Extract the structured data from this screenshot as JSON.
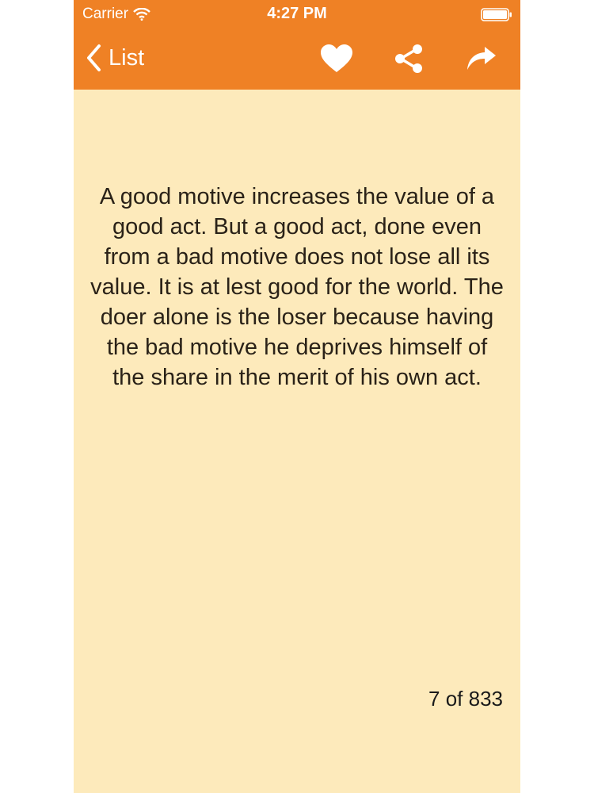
{
  "status_bar": {
    "carrier": "Carrier",
    "time": "4:27 PM",
    "icons": [
      "wifi-icon",
      "battery-icon"
    ]
  },
  "nav_bar": {
    "back_label": "List",
    "icons": [
      "chevron-left-icon",
      "heart-icon",
      "share-icon",
      "forward-arrow-icon"
    ]
  },
  "quote": {
    "text": "A good motive increases the value of a good act. But a good act, done even from a bad motive does not lose all its value. It is at lest good for the world. The doer alone is the loser because having the bad motive he deprives himself of the share in the merit of his own act."
  },
  "pager": {
    "counter": "7 of 833"
  },
  "colors": {
    "accent": "#ef8125",
    "background": "#fdeabb",
    "text": "#2a2218"
  }
}
